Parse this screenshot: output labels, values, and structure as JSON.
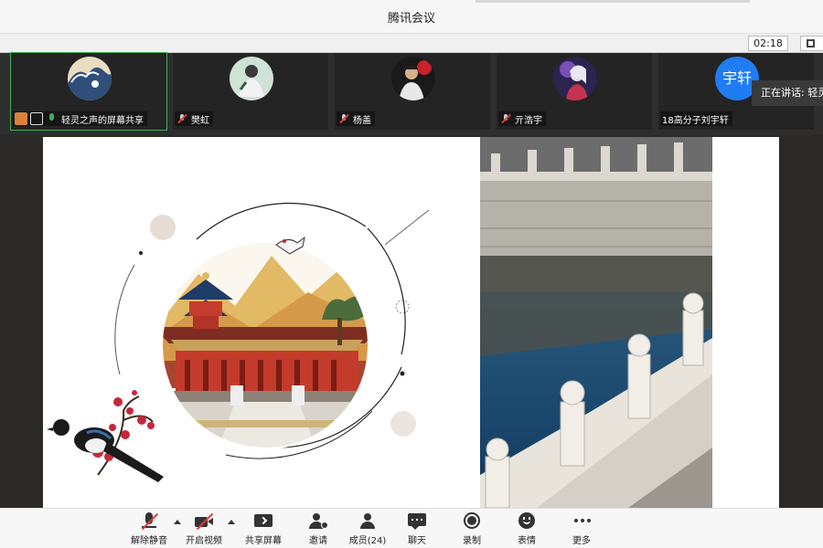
{
  "window": {
    "title": "腾讯会议"
  },
  "topbar": {
    "timer": "02:18"
  },
  "participants": [
    {
      "name": "轻灵之声的屏幕共享",
      "active": true
    },
    {
      "name": "樊虹"
    },
    {
      "name": "杨盖"
    },
    {
      "name": "亓浩宇"
    },
    {
      "name": "18高分子刘宇轩",
      "avatar_text": "宇轩"
    }
  ],
  "speaking": {
    "label": "正在讲话: 轻灵"
  },
  "toolbar": {
    "unmute": "解除静音",
    "start_video": "开启视频",
    "share_screen": "共享屏幕",
    "invite": "邀请",
    "members": "成员(24)",
    "chat": "聊天",
    "record": "录制",
    "emoji": "表情",
    "more": "更多"
  },
  "colors": {
    "accent": "#1f7cf2",
    "active_outline": "#3fae55",
    "mute_red": "#e03a3a"
  }
}
